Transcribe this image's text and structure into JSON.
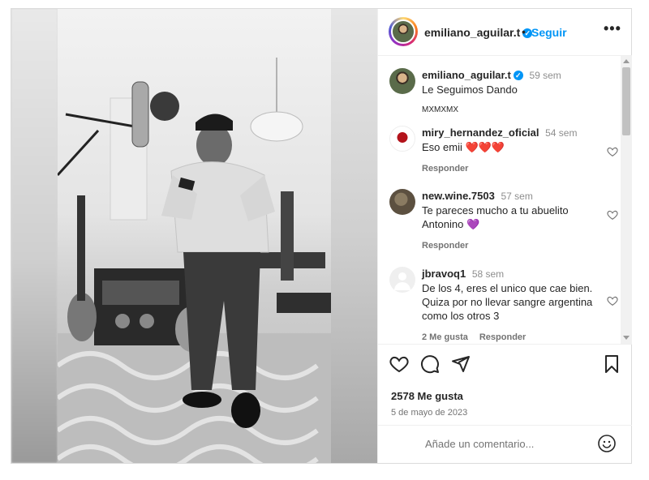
{
  "post": {
    "username": "emiliano_aguilar.t",
    "follow_label": "Seguir",
    "separator": "•",
    "more_label": "•••"
  },
  "comments": [
    {
      "user": "emiliano_aguilar.t",
      "time": "59 sem",
      "text": "Le Seguimos Dando",
      "meta": "MXMXMX"
    },
    {
      "user": "miry_hernandez_oficial",
      "time": "54 sem",
      "text": "Eso emii",
      "emoji": "❤️❤️❤️",
      "reply": "Responder"
    },
    {
      "user": "new.wine.7503",
      "time": "57 sem",
      "text": "Te pareces mucho a tu abuelito Antonino",
      "emoji": "💜",
      "reply": "Responder"
    },
    {
      "user": "jbravoq1",
      "time": "58 sem",
      "text": "De los 4, eres el unico que cae bien. Quiza por no llevar sangre argentina como los otros 3",
      "likes": "2 Me gusta",
      "reply": "Responder"
    }
  ],
  "stats": {
    "likes": "2578 Me gusta",
    "date": "5 de mayo de 2023"
  },
  "composer": {
    "placeholder": "Añade un comentario..."
  },
  "icons": [
    "heart-icon",
    "comment-icon",
    "share-icon",
    "bookmark-icon",
    "emoji-icon",
    "verified-icon"
  ],
  "colors": {
    "accent": "#0095f6",
    "text": "#262626",
    "muted": "#737373"
  }
}
